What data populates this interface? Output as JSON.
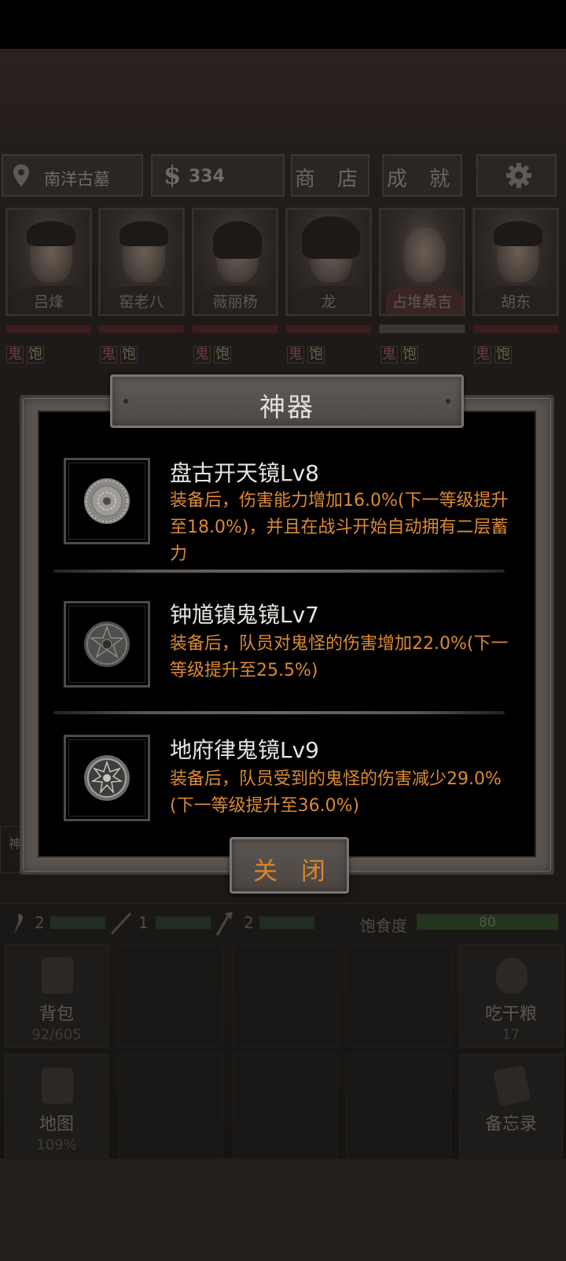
{
  "header": {
    "location": "南洋古墓",
    "money": "334",
    "shop_label": "商 店",
    "achievements_label": "成 就",
    "settings_icon": "gear-icon"
  },
  "team": [
    {
      "name": "吕烽",
      "bar": "red"
    },
    {
      "name": "窑老八",
      "bar": "red"
    },
    {
      "name": "薇丽杨",
      "bar": "red"
    },
    {
      "name": "龙",
      "bar": "red"
    },
    {
      "name": "占堆桑吉",
      "bar": "grey"
    },
    {
      "name": "胡东",
      "bar": "red"
    }
  ],
  "status_tags": {
    "ghost": "鬼",
    "full": "饱"
  },
  "modal": {
    "title": "神器",
    "artifacts": [
      {
        "name": "盘古开天镜Lv8",
        "description": "装备后，伤害能力增加16.0%(下一等级提升至18.0%)，并且在战斗开始自动拥有二层蓄力"
      },
      {
        "name": "钟馗镇鬼镜Lv7",
        "description": "装备后，队员对鬼怪的伤害增加22.0%(下一等级提升至25.5%)"
      },
      {
        "name": "地府律鬼镜Lv9",
        "description": "装备后，队员受到的鬼怪的伤害减少29.0%(下一等级提升至36.0%)"
      }
    ],
    "close_label": "关 闭"
  },
  "resources": {
    "torch": "2",
    "rope": "1",
    "shovel": "2",
    "satiety_label": "饱食度",
    "satiety_value": "80"
  },
  "side_tab": "神",
  "tiles": {
    "backpack": {
      "label": "背包",
      "value": "92/605"
    },
    "eat": {
      "label": "吃干粮",
      "value": "17"
    },
    "map": {
      "label": "地图",
      "value": "109%"
    },
    "memo": {
      "label": "备忘录"
    }
  },
  "colors": {
    "desc_orange": "#de8a31",
    "title_white": "#e4e0dc",
    "frame_grey": "#5b5551"
  }
}
